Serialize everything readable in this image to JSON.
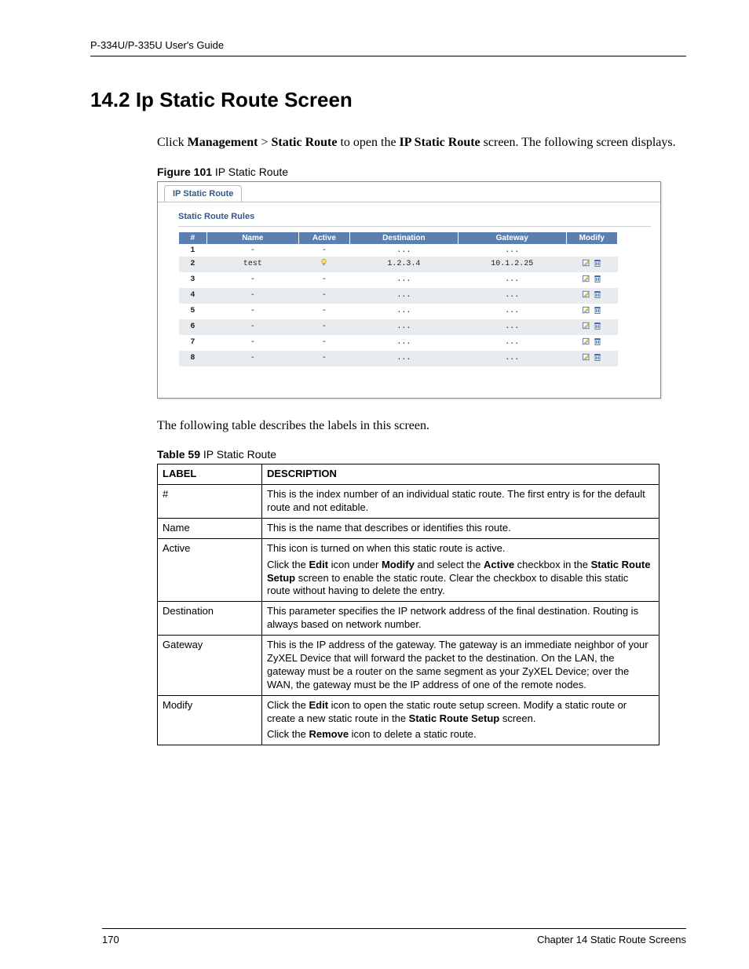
{
  "header": "P-334U/P-335U User's Guide",
  "section_title": "14.2  Ip Static Route Screen",
  "intro_html": "Click <b>Management</b> > <b>Static Route</b> to open the <b>IP Static Route</b> screen. The following screen displays.",
  "figure_label_bold": "Figure 101",
  "figure_label_rest": "   IP Static Route",
  "screenshot": {
    "tab": "IP Static Route",
    "subtitle": "Static Route Rules",
    "headers": [
      "#",
      "Name",
      "Active",
      "Destination",
      "Gateway",
      "Modify"
    ],
    "rows": [
      {
        "idx": "1",
        "name": "-",
        "active": "-",
        "dest": "...",
        "gw": "...",
        "modify": false
      },
      {
        "idx": "2",
        "name": "test",
        "active": "bulb",
        "dest": "1.2.3.4",
        "gw": "10.1.2.25",
        "modify": true
      },
      {
        "idx": "3",
        "name": "-",
        "active": "-",
        "dest": "...",
        "gw": "...",
        "modify": true
      },
      {
        "idx": "4",
        "name": "-",
        "active": "-",
        "dest": "...",
        "gw": "...",
        "modify": true
      },
      {
        "idx": "5",
        "name": "-",
        "active": "-",
        "dest": "...",
        "gw": "...",
        "modify": true
      },
      {
        "idx": "6",
        "name": "-",
        "active": "-",
        "dest": "...",
        "gw": "...",
        "modify": true
      },
      {
        "idx": "7",
        "name": "-",
        "active": "-",
        "dest": "...",
        "gw": "...",
        "modify": true
      },
      {
        "idx": "8",
        "name": "-",
        "active": "-",
        "dest": "...",
        "gw": "...",
        "modify": true
      }
    ]
  },
  "after_figure_text": "The following table describes the labels in this screen.",
  "table_label_bold": "Table 59",
  "table_label_rest": "   IP Static Route",
  "desc_table": {
    "header_label": "LABEL",
    "header_desc": "DESCRIPTION",
    "rows": [
      {
        "label": "#",
        "desc_html": "This is the index number of an individual static route. The first entry is for the default route and not editable."
      },
      {
        "label": "Name",
        "desc_html": "This is the name that describes or identifies this route."
      },
      {
        "label": "Active",
        "desc_html": "<p>This icon is turned on when this static route is active.</p><p>Click the <b>Edit</b> icon under <b>Modify</b> and select the <b>Active</b> checkbox in the <b>Static Route Setup</b> screen to enable the static route. Clear the checkbox to disable this static route without having to delete the entry.</p>"
      },
      {
        "label": "Destination",
        "desc_html": "This parameter specifies the IP network address of the final destination. Routing is always based on network number."
      },
      {
        "label": "Gateway",
        "desc_html": "This is the IP address of the gateway. The gateway is an immediate neighbor of your ZyXEL Device that will forward the packet to the destination. On the LAN, the gateway must be a router on the same segment as your ZyXEL Device; over the WAN, the gateway must be the IP address of one of the remote nodes."
      },
      {
        "label": "Modify",
        "desc_html": "<p>Click the <b>Edit</b> icon to open the static route setup screen. Modify a static route or create a new static route in the <b>Static Route Setup</b> screen.</p><p>Click the <b>Remove</b> icon to delete a static route.</p>"
      }
    ]
  },
  "footer": {
    "page": "170",
    "chapter": "Chapter 14 Static Route Screens"
  }
}
